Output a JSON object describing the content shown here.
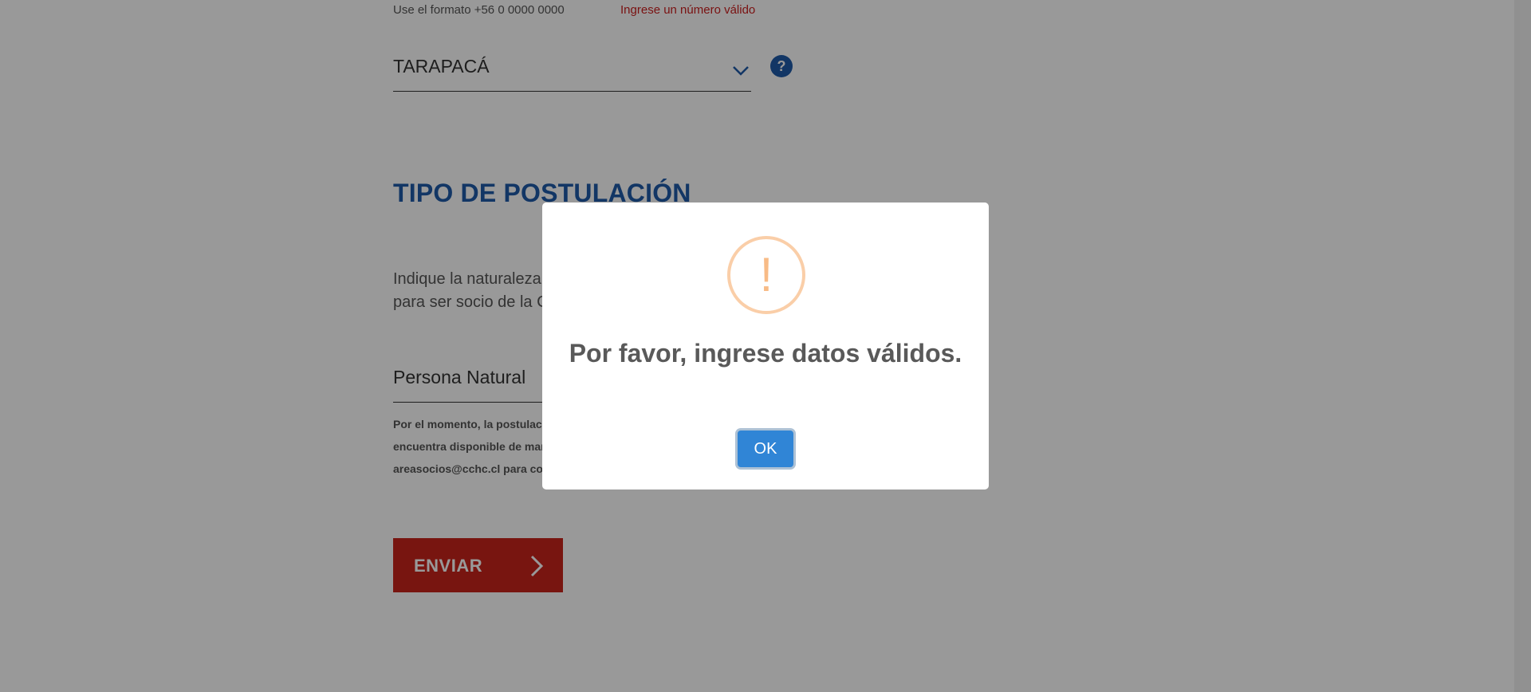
{
  "form": {
    "phone_hint": "Use el formato +56 0 0000 0000",
    "phone_error": "Ingrese un número válido",
    "region_value": "TARAPACÁ",
    "help_symbol": "?",
    "section_title": "TIPO DE POSTULACIÓN",
    "section_desc_line1": "Indique la naturaleza",
    "section_desc_line2": "para ser socio de la C",
    "type_value": "Persona Natural",
    "notice_line1": "Por el momento, la postulaci",
    "notice_line2": "encuentra disponible de man",
    "notice_line3": "areasocios@cchc.cl para con",
    "send_label": "ENVIAR"
  },
  "modal": {
    "icon_symbol": "!",
    "title": "Por favor, ingrese datos válidos.",
    "ok_label": "OK"
  },
  "colors": {
    "accent_blue": "#1f5aa8",
    "error_red": "#cc1f1f",
    "send_red": "#c8231c",
    "ok_blue": "#3085d6",
    "warning_orange": "#f8bb86"
  },
  "icons": {
    "dropdown": "chevron-down-icon",
    "help": "help-icon",
    "send": "chevron-right-icon",
    "modal": "warning-icon"
  }
}
